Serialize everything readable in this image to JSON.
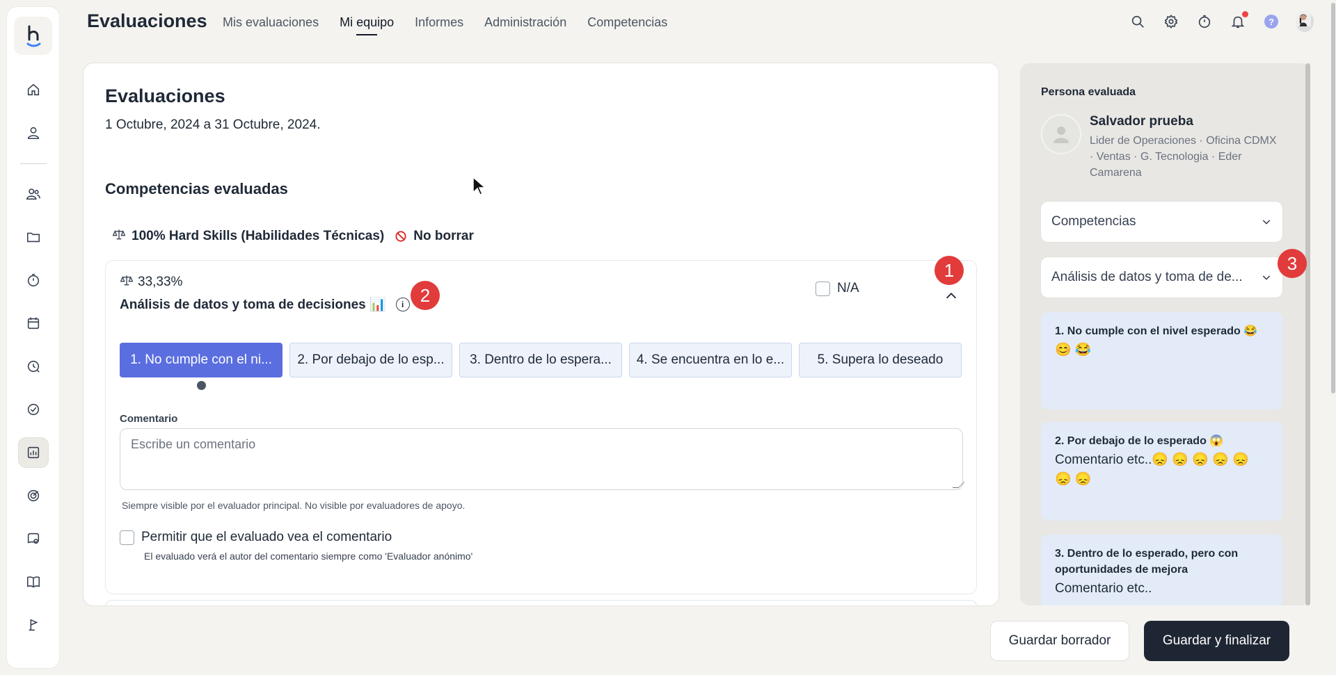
{
  "app": {
    "title": "Evaluaciones",
    "nav": [
      "Mis evaluaciones",
      "Mi equipo",
      "Informes",
      "Administración",
      "Competencias"
    ],
    "active_nav": "Mi equipo"
  },
  "sidebar": {
    "icons": [
      "home-icon",
      "user-icon",
      "users-icon",
      "folder-icon",
      "stopwatch-icon",
      "calendar-icon",
      "clock-history-icon",
      "check-circle-icon",
      "chart-icon",
      "target-icon",
      "chat-search-icon",
      "book-icon",
      "flag-icon"
    ],
    "active": "chart-icon"
  },
  "main": {
    "title": "Evaluaciones",
    "date_range": "1 Octubre, 2024 a 31 Octubre, 2024.",
    "section_title": "Competencias evaluadas",
    "group_label": "100% Hard Skills (Habilidades Técnicas)",
    "group_tag": "No borrar",
    "competency": {
      "weight": "33,33%",
      "name": "Análisis de datos y toma de decisiones 📊",
      "na_label": "N/A",
      "levels": [
        "1. No cumple con el ni...",
        "2. Por debajo de lo esp...",
        "3. Dentro de lo espera...",
        "4. Se encuentra en lo e...",
        "5. Supera lo deseado"
      ],
      "selected_level": 1,
      "comment_label": "Comentario",
      "comment_placeholder": "Escribe un comentario",
      "visibility_note": "Siempre visible por el evaluador principal. No visible por evaluadores de apoyo.",
      "permit_label": "Permitir que el evaluado vea el comentario",
      "permit_note": "El evaluado verá el autor del comentario siempre como 'Evaluador anónimo'"
    }
  },
  "right_panel": {
    "title": "Persona evaluada",
    "person_name": "Salvador prueba",
    "person_detail": "Lider de Operaciones · Oficina CDMX · Ventas · G. Tecnologia · Eder Camarena",
    "select_1": "Competencias",
    "select_2": "Análisis de datos y toma de de...",
    "level_cards": [
      {
        "title": "1. No cumple con el nivel esperado 😂",
        "body": "😊 😂"
      },
      {
        "title": "2. Por debajo de lo esperado 😱",
        "body": "Comentario etc..😞 😞 😞 😞 😞 😞 😞"
      },
      {
        "title": "3. Dentro de lo esperado, pero con oportunidades de mejora",
        "body": "Comentario etc.."
      }
    ]
  },
  "buttons": {
    "draft": "Guardar borrador",
    "finalize": "Guardar y finalizar"
  },
  "markers": [
    "1",
    "2",
    "3"
  ],
  "colors": {
    "accent": "#5a6ee0",
    "primary_button": "#1f2633",
    "marker": "#e23b3b",
    "level_bg": "#eef3fb"
  }
}
